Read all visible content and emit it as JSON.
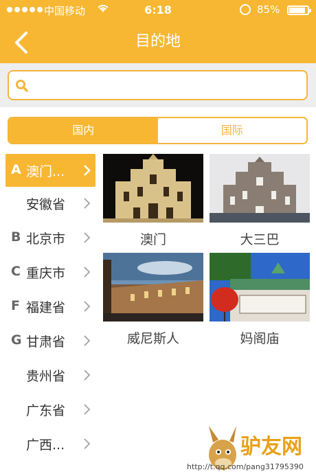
{
  "status_bar": {
    "carrier": "中国移动",
    "time": "6:18",
    "battery": "85%"
  },
  "nav": {
    "title": "目的地",
    "back_icon": "chevron-left-icon"
  },
  "search": {
    "placeholder": "",
    "value": "",
    "icon": "search-icon"
  },
  "segments": {
    "domestic": "国内",
    "international": "国际",
    "selected": "domestic"
  },
  "sidebar": {
    "items": [
      {
        "letter": "A",
        "label": "澳门...",
        "active": true
      },
      {
        "letter": "",
        "label": "安徽省",
        "active": false
      },
      {
        "letter": "B",
        "label": "北京市",
        "active": false
      },
      {
        "letter": "C",
        "label": "重庆市",
        "active": false
      },
      {
        "letter": "F",
        "label": "福建省",
        "active": false
      },
      {
        "letter": "G",
        "label": "甘肃省",
        "active": false
      },
      {
        "letter": "",
        "label": "贵州省",
        "active": false
      },
      {
        "letter": "",
        "label": "广东省",
        "active": false
      },
      {
        "letter": "",
        "label": "广西...",
        "active": false
      }
    ]
  },
  "destinations": [
    {
      "name": "澳门"
    },
    {
      "name": "大三巴"
    },
    {
      "name": "威尼斯人"
    },
    {
      "name": "妈阁庙"
    }
  ],
  "colors": {
    "accent": "#f8b733",
    "border": "#f3b53a"
  },
  "watermark": {
    "brand": "驴友网",
    "url": "http://t.qq.com/pang31795390"
  }
}
